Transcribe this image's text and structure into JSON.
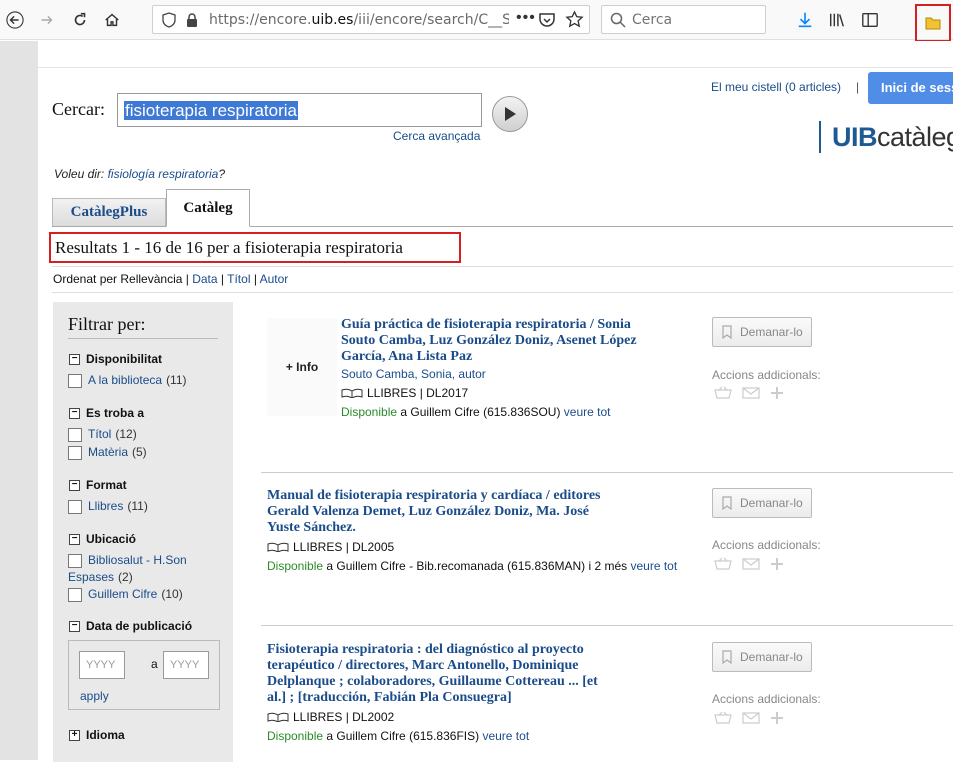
{
  "browser": {
    "url_prefix": "https://encore.",
    "url_domain": "uib.es",
    "url_rest": "/iii/encore/search/C__Sfisiot",
    "search_placeholder": "Cerca"
  },
  "header": {
    "cart_link": "El meu cistell (0 articles)",
    "pipe": "|",
    "login_button": "Inici de sessió",
    "logo_uib": "UIB",
    "logo_cat": "catàleg"
  },
  "search": {
    "label": "Cercar:",
    "query": "fisioterapia respiratoria",
    "advanced_link": "Cerca avançada",
    "suggest_prefix": "Voleu dir: ",
    "suggest_link": "fisiología respiratoria",
    "suggest_suffix": "?"
  },
  "tabs": [
    {
      "label": "CatàlegPlus"
    },
    {
      "label": "Catàleg"
    }
  ],
  "results_heading": "Resultats 1 - 16 de 16 per a fisioterapia respiratoria",
  "sort": {
    "prefix": "Ordenat per  Rellevància",
    "sep": " | ",
    "options": [
      "Data",
      "Títol",
      "Autor"
    ]
  },
  "filter": {
    "title": "Filtrar per:",
    "groups": [
      {
        "label": "Disponibilitat",
        "items": [
          {
            "label": "A la biblioteca",
            "count": "(11)"
          }
        ]
      },
      {
        "label": "Es troba a",
        "items": [
          {
            "label": "Títol",
            "count": "(12)"
          },
          {
            "label": "Matèria",
            "count": "(5)"
          }
        ]
      },
      {
        "label": "Format",
        "items": [
          {
            "label": "Llibres",
            "count": "(11)"
          }
        ]
      },
      {
        "label": "Ubicació",
        "items": [
          {
            "label": "Bibliosalut - H.Son",
            "label2": "Espases",
            "count": "(2)"
          },
          {
            "label": "Guillem Cifre",
            "count": "(10)"
          }
        ]
      },
      {
        "label": "Data de publicació"
      },
      {
        "label": "Idioma"
      }
    ],
    "date_from_placeholder": "YYYY",
    "date_to_placeholder": "YYYY",
    "date_and": "a",
    "apply": "apply"
  },
  "results": [
    {
      "thumb": "+ Info",
      "title_lines": [
        "Guía práctica de fisioterapia respiratoria / Sonia",
        "Souto Camba, Luz González Doniz, Asenet López",
        "García, Ana Lista Paz"
      ],
      "author": "Souto Camba, Sonia, autor",
      "format": "LLIBRES   |   DL2017",
      "availability": "Disponible",
      "location": " a Guillem Cifre (615.836SOU)  ",
      "veure": "veure tot",
      "request": "Demanar-lo",
      "actions": "Accions addicionals:"
    },
    {
      "title_lines": [
        "Manual de fisioterapia respiratoria y cardíaca / editores",
        "Gerald Valenza Demet, Luz González Doniz, Ma. José",
        "Yuste Sánchez."
      ],
      "format": "LLIBRES   |   DL2005",
      "availability": "Disponible",
      "location": " a Guillem Cifre - Bib.recomanada (615.836MAN) i 2 més  ",
      "veure": "veure tot",
      "request": "Demanar-lo",
      "actions": "Accions addicionals:"
    },
    {
      "title_lines": [
        "Fisioterapia respiratoria : del diagnóstico al proyecto",
        "terapéutico / directores, Marc Antonello, Dominique",
        "Delplanque ; colaboradores, Guillaume Cottereau ... [et",
        "al.] ; [traducción, Fabián Pla Consuegra]"
      ],
      "format": "LLIBRES   |   DL2002",
      "availability": "Disponible",
      "location": " a Guillem Cifre (615.836FIS)  ",
      "veure": "veure tot",
      "request": "Demanar-lo",
      "actions": "Accions addicionals:"
    }
  ]
}
